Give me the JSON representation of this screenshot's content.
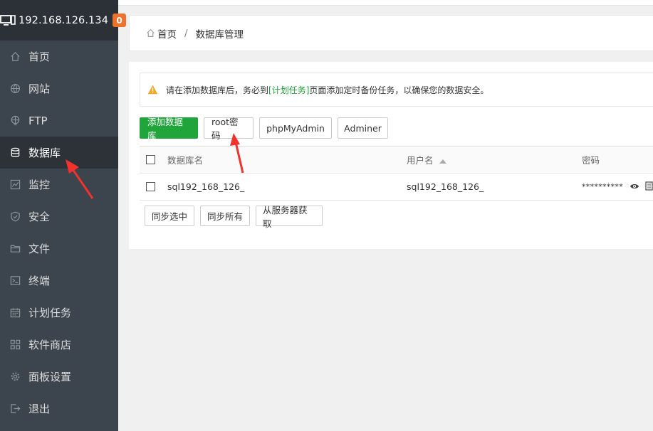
{
  "sidebar": {
    "ip": "192.168.126.134",
    "badge": "0",
    "items": [
      {
        "label": "首页",
        "icon": "home-icon"
      },
      {
        "label": "网站",
        "icon": "globe-icon"
      },
      {
        "label": "FTP",
        "icon": "ftp-icon"
      },
      {
        "label": "数据库",
        "icon": "database-icon"
      },
      {
        "label": "监控",
        "icon": "monitor-chart-icon"
      },
      {
        "label": "安全",
        "icon": "shield-icon"
      },
      {
        "label": "文件",
        "icon": "folder-icon"
      },
      {
        "label": "终端",
        "icon": "terminal-icon"
      },
      {
        "label": "计划任务",
        "icon": "calendar-icon"
      },
      {
        "label": "软件商店",
        "icon": "grid-icon"
      },
      {
        "label": "面板设置",
        "icon": "gear-icon"
      },
      {
        "label": "退出",
        "icon": "logout-icon"
      }
    ]
  },
  "breadcrumb": {
    "home": "首页",
    "separator": "/",
    "current": "数据库管理"
  },
  "alert": {
    "before": "请在添加数据库后，务必到",
    "link": "[计划任务]",
    "after": "页面添加定时备份任务，以确保您的数据安全。"
  },
  "toolbar": {
    "add_db": "添加数据库",
    "root_password": "root密码",
    "phpmyadmin": "phpMyAdmin",
    "adminer": "Adminer"
  },
  "table": {
    "headers": {
      "name": "数据库名",
      "user": "用户名",
      "password": "密码"
    },
    "rows": [
      {
        "name": "sql192_168_126_",
        "user": "sql192_168_126_",
        "password": "**********"
      }
    ]
  },
  "footer_buttons": {
    "sync_selected": "同步选中",
    "sync_all": "同步所有",
    "fetch_server": "从服务器获取"
  },
  "colors": {
    "accent_green": "#20a53a",
    "sidebar_bg": "#3c444d",
    "badge_orange": "#f0712c",
    "arrow_red": "#f2332d"
  }
}
